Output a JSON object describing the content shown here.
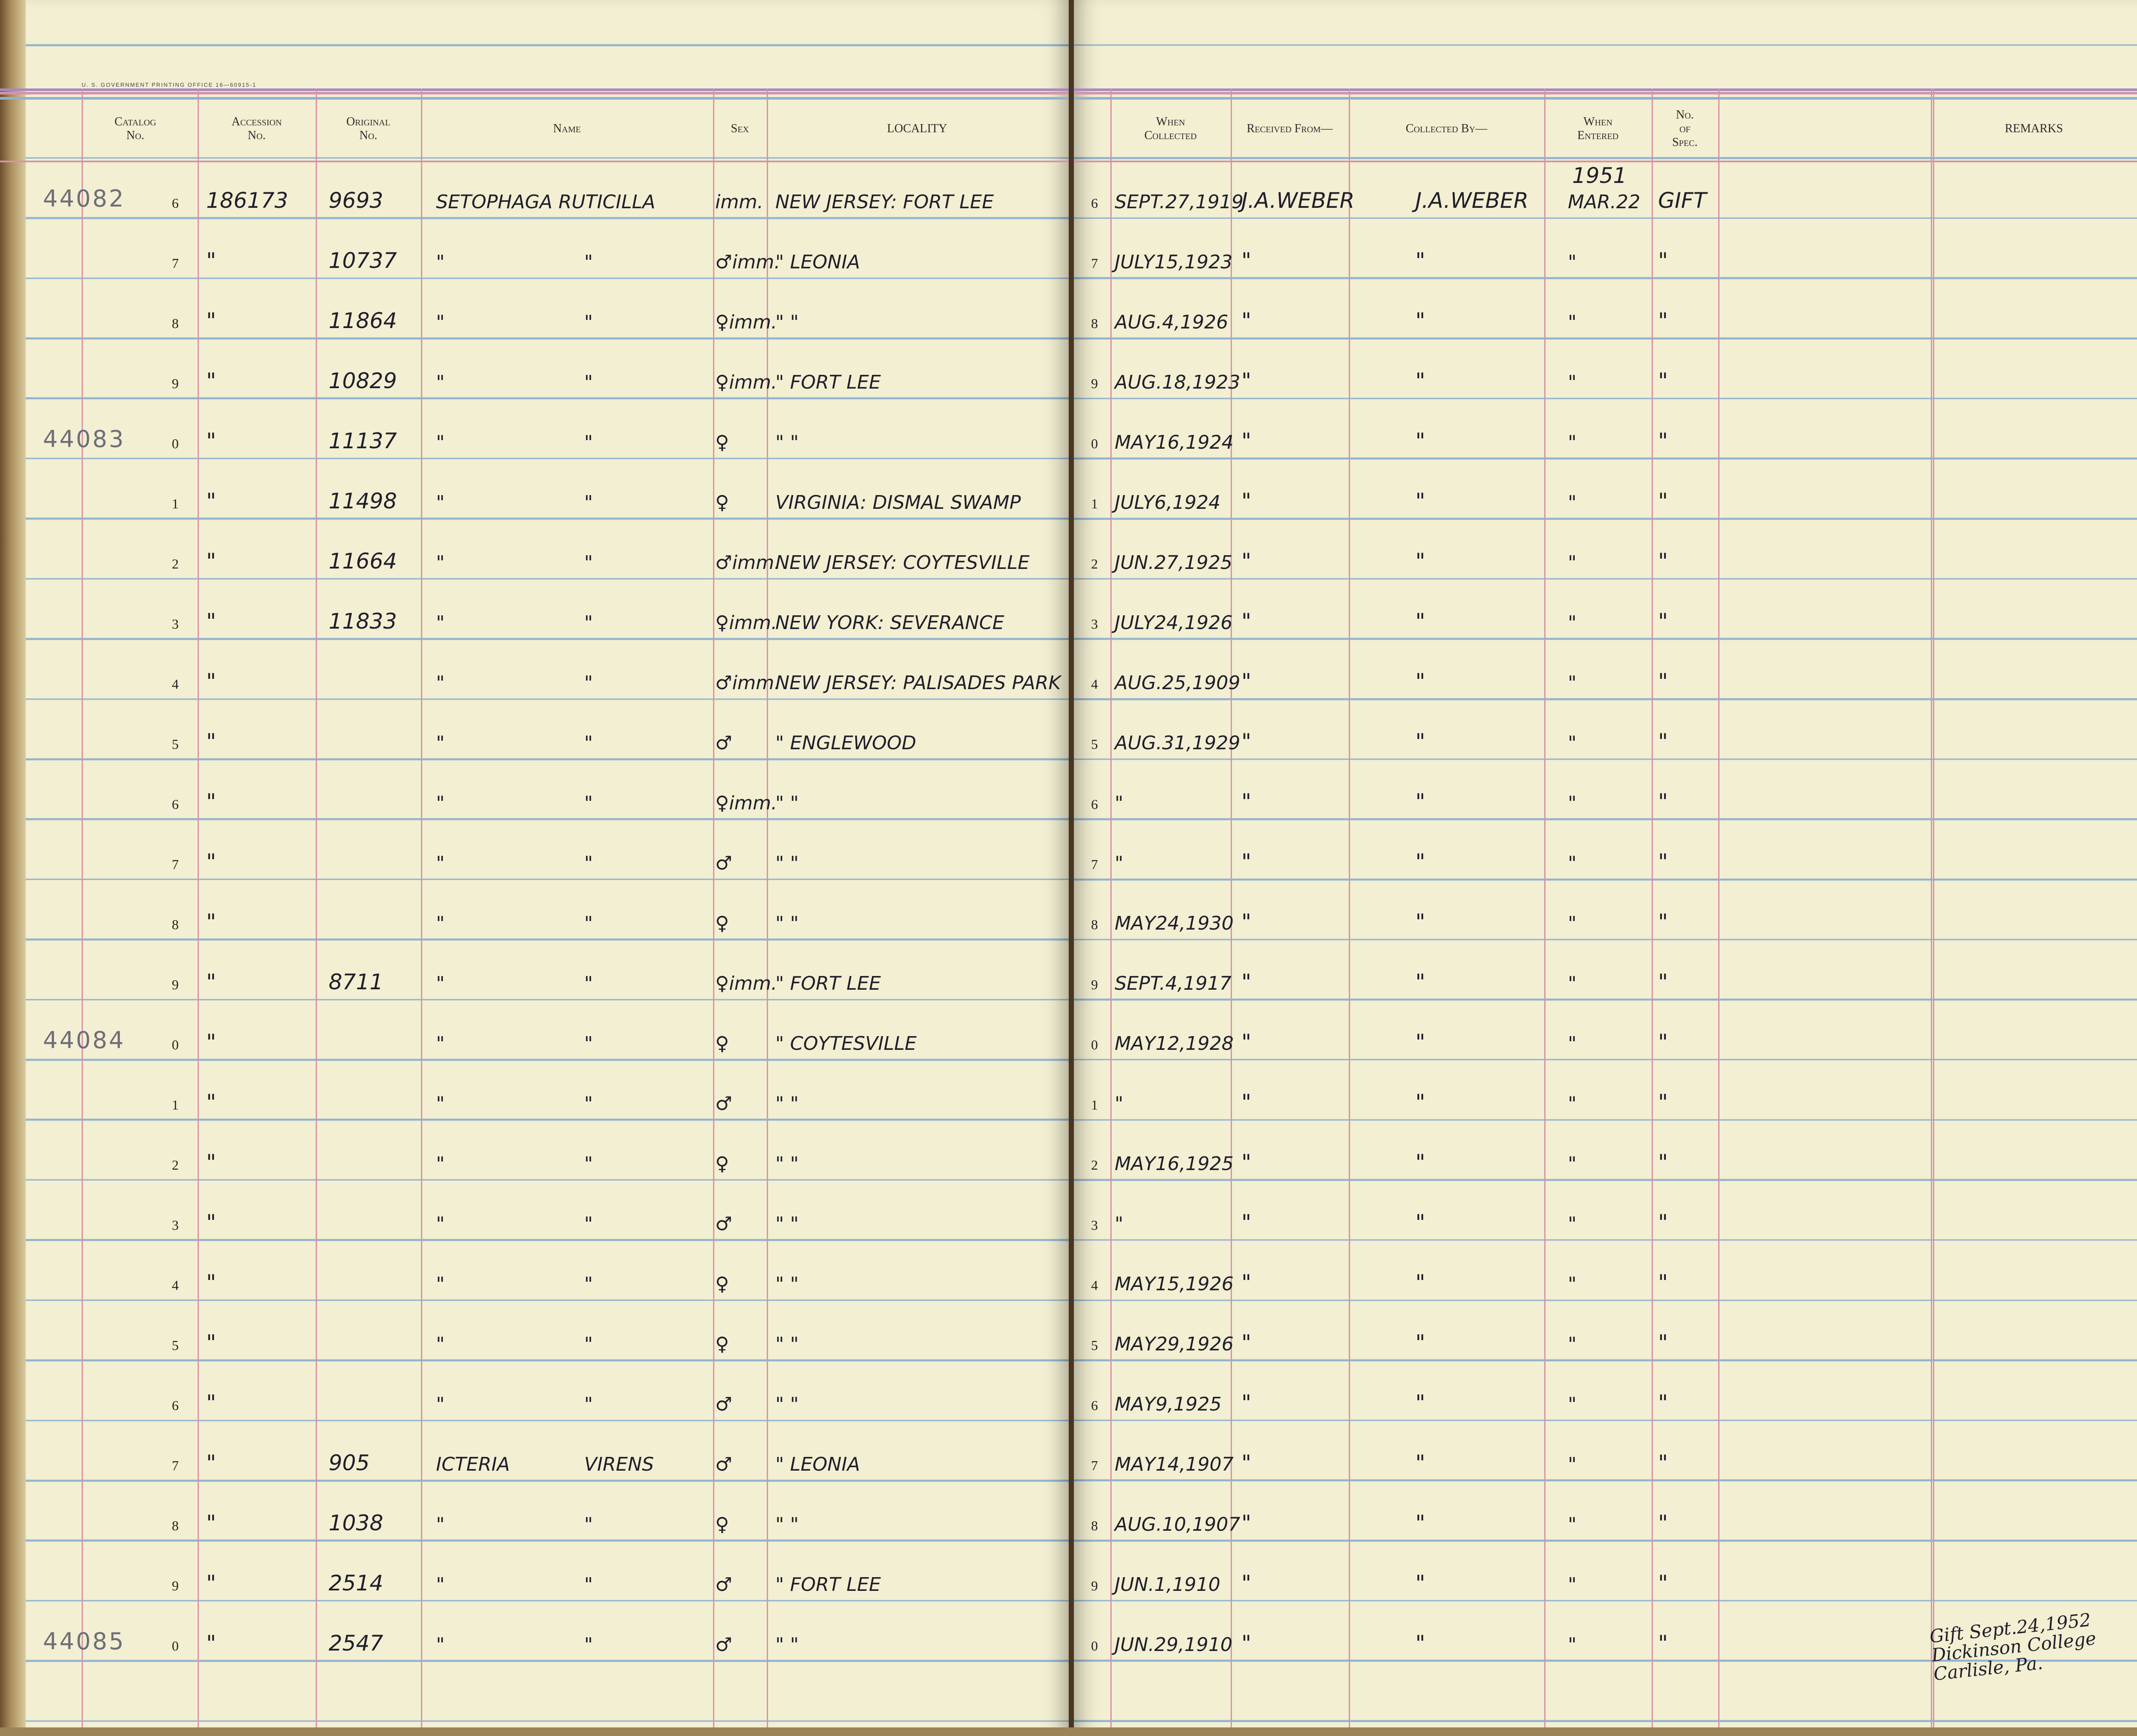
{
  "imprint": "U. S. GOVERNMENT PRINTING OFFICE    16—60915-1",
  "headers": {
    "catalog": [
      "Catalog",
      "No."
    ],
    "accession": [
      "Accession",
      "No."
    ],
    "original": [
      "Original",
      "No."
    ],
    "name": [
      "Name"
    ],
    "sex": [
      "Sex"
    ],
    "locality": [
      "LOCALITY"
    ],
    "when_collected": [
      "When",
      "Collected"
    ],
    "received_from": [
      "Received From—"
    ],
    "collected_by": [
      "Collected By—"
    ],
    "when_entered": [
      "When",
      "Entered"
    ],
    "no_of_spec": [
      "No.",
      "of",
      "Spec."
    ],
    "remarks": [
      "REMARKS"
    ]
  },
  "year_annotation": "1951",
  "rows": [
    {
      "catalog": "44082",
      "digit": "6",
      "accession": "186173",
      "original": "9693",
      "name1": "SETOPHAGA RUTICILLA",
      "name2": "",
      "sex": "imm.",
      "locality": "NEW JERSEY: FORT LEE",
      "rdigit": "6",
      "collected": "SEPT.27,1919",
      "received": "J.A.WEBER",
      "collector": "J.A.WEBER",
      "entered": "MAR.22",
      "spec": "GIFT"
    },
    {
      "catalog": "",
      "digit": "7",
      "accession": "\"",
      "original": "10737",
      "name1": "\"",
      "name2": "\"",
      "sex": "♂imm.",
      "locality": "\"          LEONIA",
      "rdigit": "7",
      "collected": "JULY15,1923",
      "received": "\"",
      "collector": "\"",
      "entered": "\"",
      "spec": "\""
    },
    {
      "catalog": "",
      "digit": "8",
      "accession": "\"",
      "original": "11864",
      "name1": "\"",
      "name2": "\"",
      "sex": "♀imm.",
      "locality": "\"          \"",
      "rdigit": "8",
      "collected": "AUG.4,1926",
      "received": "\"",
      "collector": "\"",
      "entered": "\"",
      "spec": "\""
    },
    {
      "catalog": "",
      "digit": "9",
      "accession": "\"",
      "original": "10829",
      "name1": "\"",
      "name2": "\"",
      "sex": "♀imm.",
      "locality": "\"       FORT LEE",
      "rdigit": "9",
      "collected": "AUG.18,1923",
      "received": "\"",
      "collector": "\"",
      "entered": "\"",
      "spec": "\""
    },
    {
      "catalog": "44083",
      "digit": "0",
      "accession": "\"",
      "original": "11137",
      "name1": "\"",
      "name2": "\"",
      "sex": "♀",
      "locality": "\"          \"",
      "rdigit": "0",
      "collected": "MAY16,1924",
      "received": "\"",
      "collector": "\"",
      "entered": "\"",
      "spec": "\""
    },
    {
      "catalog": "",
      "digit": "1",
      "accession": "\"",
      "original": "11498",
      "name1": "\"",
      "name2": "\"",
      "sex": "♀",
      "locality": "VIRGINIA: DISMAL SWAMP",
      "rdigit": "1",
      "collected": "JULY6,1924",
      "received": "\"",
      "collector": "\"",
      "entered": "\"",
      "spec": "\""
    },
    {
      "catalog": "",
      "digit": "2",
      "accession": "\"",
      "original": "11664",
      "name1": "\"",
      "name2": "\"",
      "sex": "♂imm.",
      "locality": "NEW JERSEY: COYTESVILLE",
      "rdigit": "2",
      "collected": "JUN.27,1925",
      "received": "\"",
      "collector": "\"",
      "entered": "\"",
      "spec": "\""
    },
    {
      "catalog": "",
      "digit": "3",
      "accession": "\"",
      "original": "11833",
      "name1": "\"",
      "name2": "\"",
      "sex": "♀imm.",
      "locality": "NEW YORK: SEVERANCE",
      "rdigit": "3",
      "collected": "JULY24,1926",
      "received": "\"",
      "collector": "\"",
      "entered": "\"",
      "spec": "\""
    },
    {
      "catalog": "",
      "digit": "4",
      "accession": "\"",
      "original": "",
      "name1": "\"",
      "name2": "\"",
      "sex": "♂imm.",
      "locality": "NEW JERSEY: PALISADES PARK",
      "rdigit": "4",
      "collected": "AUG.25,1909",
      "received": "\"",
      "collector": "\"",
      "entered": "\"",
      "spec": "\""
    },
    {
      "catalog": "",
      "digit": "5",
      "accession": "\"",
      "original": "",
      "name1": "\"",
      "name2": "\"",
      "sex": "♂",
      "locality": "\"     ENGLEWOOD",
      "rdigit": "5",
      "collected": "AUG.31,1929",
      "received": "\"",
      "collector": "\"",
      "entered": "\"",
      "spec": "\""
    },
    {
      "catalog": "",
      "digit": "6",
      "accession": "\"",
      "original": "",
      "name1": "\"",
      "name2": "\"",
      "sex": "♀imm.",
      "locality": "\"          \"",
      "rdigit": "6",
      "collected": "\"",
      "received": "\"",
      "collector": "\"",
      "entered": "\"",
      "spec": "\""
    },
    {
      "catalog": "",
      "digit": "7",
      "accession": "\"",
      "original": "",
      "name1": "\"",
      "name2": "\"",
      "sex": "♂",
      "locality": "\"          \"",
      "rdigit": "7",
      "collected": "\"",
      "received": "\"",
      "collector": "\"",
      "entered": "\"",
      "spec": "\""
    },
    {
      "catalog": "",
      "digit": "8",
      "accession": "\"",
      "original": "",
      "name1": "\"",
      "name2": "\"",
      "sex": "♀",
      "locality": "\"          \"",
      "rdigit": "8",
      "collected": "MAY24,1930",
      "received": "\"",
      "collector": "\"",
      "entered": "\"",
      "spec": "\""
    },
    {
      "catalog": "",
      "digit": "9",
      "accession": "\"",
      "original": "8711",
      "name1": "\"",
      "name2": "\"",
      "sex": "♀imm.",
      "locality": "\"       FORT LEE",
      "rdigit": "9",
      "collected": "SEPT.4,1917",
      "received": "\"",
      "collector": "\"",
      "entered": "\"",
      "spec": "\""
    },
    {
      "catalog": "44084",
      "digit": "0",
      "accession": "\"",
      "original": "",
      "name1": "\"",
      "name2": "\"",
      "sex": "♀",
      "locality": "\"   COYTESVILLE",
      "rdigit": "0",
      "collected": "MAY12,1928",
      "received": "\"",
      "collector": "\"",
      "entered": "\"",
      "spec": "\""
    },
    {
      "catalog": "",
      "digit": "1",
      "accession": "\"",
      "original": "",
      "name1": "\"",
      "name2": "\"",
      "sex": "♂",
      "locality": "\"          \"",
      "rdigit": "1",
      "collected": "\"",
      "received": "\"",
      "collector": "\"",
      "entered": "\"",
      "spec": "\""
    },
    {
      "catalog": "",
      "digit": "2",
      "accession": "\"",
      "original": "",
      "name1": "\"",
      "name2": "\"",
      "sex": "♀",
      "locality": "\"          \"",
      "rdigit": "2",
      "collected": "MAY16,1925",
      "received": "\"",
      "collector": "\"",
      "entered": "\"",
      "spec": "\""
    },
    {
      "catalog": "",
      "digit": "3",
      "accession": "\"",
      "original": "",
      "name1": "\"",
      "name2": "\"",
      "sex": "♂",
      "locality": "\"          \"",
      "rdigit": "3",
      "collected": "\"",
      "received": "\"",
      "collector": "\"",
      "entered": "\"",
      "spec": "\""
    },
    {
      "catalog": "",
      "digit": "4",
      "accession": "\"",
      "original": "",
      "name1": "\"",
      "name2": "\"",
      "sex": "♀",
      "locality": "\"          \"",
      "rdigit": "4",
      "collected": "MAY15,1926",
      "received": "\"",
      "collector": "\"",
      "entered": "\"",
      "spec": "\""
    },
    {
      "catalog": "",
      "digit": "5",
      "accession": "\"",
      "original": "",
      "name1": "\"",
      "name2": "\"",
      "sex": "♀",
      "locality": "\"          \"",
      "rdigit": "5",
      "collected": "MAY29,1926",
      "received": "\"",
      "collector": "\"",
      "entered": "\"",
      "spec": "\""
    },
    {
      "catalog": "",
      "digit": "6",
      "accession": "\"",
      "original": "",
      "name1": "\"",
      "name2": "\"",
      "sex": "♂",
      "locality": "\"          \"",
      "rdigit": "6",
      "collected": "MAY9,1925",
      "received": "\"",
      "collector": "\"",
      "entered": "\"",
      "spec": "\""
    },
    {
      "catalog": "",
      "digit": "7",
      "accession": "\"",
      "original": "905",
      "name1": "ICTERIA",
      "name2": "VIRENS",
      "sex": "♂",
      "locality": "\"       LEONIA",
      "rdigit": "7",
      "collected": "MAY14,1907",
      "received": "\"",
      "collector": "\"",
      "entered": "\"",
      "spec": "\""
    },
    {
      "catalog": "",
      "digit": "8",
      "accession": "\"",
      "original": "1038",
      "name1": "\"",
      "name2": "\"",
      "sex": "♀",
      "locality": "\"          \"",
      "rdigit": "8",
      "collected": "AUG.10,1907",
      "received": "\"",
      "collector": "\"",
      "entered": "\"",
      "spec": "\""
    },
    {
      "catalog": "",
      "digit": "9",
      "accession": "\"",
      "original": "2514",
      "name1": "\"",
      "name2": "\"",
      "sex": "♂",
      "locality": "\"       FORT LEE",
      "rdigit": "9",
      "collected": "JUN.1,1910",
      "received": "\"",
      "collector": "\"",
      "entered": "\"",
      "spec": "\""
    },
    {
      "catalog": "44085",
      "digit": "0",
      "accession": "\"",
      "original": "2547",
      "name1": "\"",
      "name2": "\"",
      "sex": "♂",
      "locality": "\"          \"",
      "rdigit": "0",
      "collected": "JUN.29,1910",
      "received": "\"",
      "collector": "\"",
      "entered": "\"",
      "spec": "\""
    }
  ],
  "remarks_note": [
    "Gift Sept.24,1952",
    "Dickinson College",
    "Carlisle, Pa."
  ],
  "colors": {
    "paper": "#f3efd2",
    "ruled_blue": "#8fb3cf",
    "ruled_red": "#d693a9",
    "ink": "#1f1f2b",
    "pencil": "#6e6e78"
  }
}
